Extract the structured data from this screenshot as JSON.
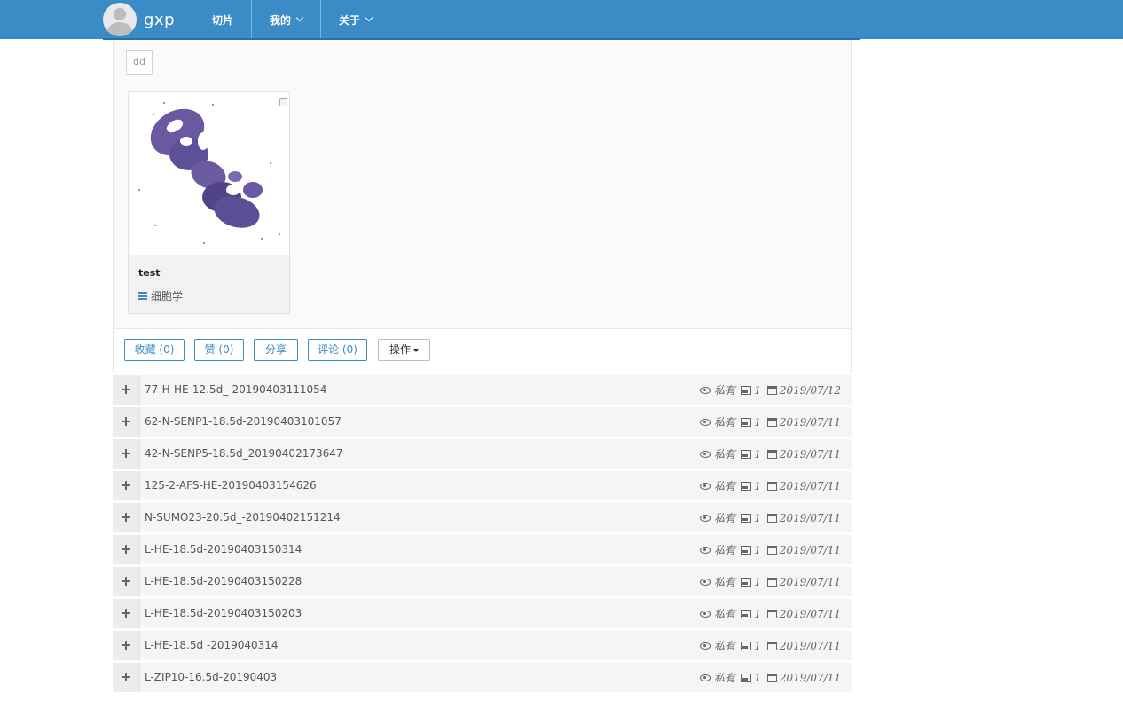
{
  "navbar": {
    "brand": "gxp",
    "items": [
      {
        "label": "切片",
        "dropdown": false
      },
      {
        "label": "我的",
        "dropdown": true
      },
      {
        "label": "关于",
        "dropdown": true
      }
    ]
  },
  "panel": {
    "tag": "dd",
    "card": {
      "title": "test",
      "category": "细胞学"
    },
    "actions": {
      "favorite": "收藏 (0)",
      "like": "赞 (0)",
      "share": "分享",
      "comment": "评论 (0)",
      "operations": "操作"
    }
  },
  "rows": [
    {
      "name": "77-H-HE-12.5d_-20190403111054",
      "visibility": "私有",
      "count": "1",
      "date": "2019/07/12"
    },
    {
      "name": "62-N-SENP1-18.5d-20190403101057",
      "visibility": "私有",
      "count": "1",
      "date": "2019/07/11"
    },
    {
      "name": "42-N-SENP5-18.5d_20190402173647",
      "visibility": "私有",
      "count": "1",
      "date": "2019/07/11"
    },
    {
      "name": "125-2-AFS-HE-20190403154626",
      "visibility": "私有",
      "count": "1",
      "date": "2019/07/11"
    },
    {
      "name": "N-SUMO23-20.5d_-20190402151214",
      "visibility": "私有",
      "count": "1",
      "date": "2019/07/11"
    },
    {
      "name": "L-HE-18.5d-20190403150314",
      "visibility": "私有",
      "count": "1",
      "date": "2019/07/11"
    },
    {
      "name": "L-HE-18.5d-20190403150228",
      "visibility": "私有",
      "count": "1",
      "date": "2019/07/11"
    },
    {
      "name": "L-HE-18.5d-20190403150203",
      "visibility": "私有",
      "count": "1",
      "date": "2019/07/11"
    },
    {
      "name": "L-HE-18.5d -2019040314",
      "visibility": "私有",
      "count": "1",
      "date": "2019/07/11"
    },
    {
      "name": "L-ZIP10-16.5d-20190403",
      "visibility": "私有",
      "count": "1",
      "date": "2019/07/11"
    }
  ],
  "colors": {
    "navbar": "#3b8bc6",
    "accent": "#3b8bc6",
    "stain": "#4a3a8a"
  }
}
